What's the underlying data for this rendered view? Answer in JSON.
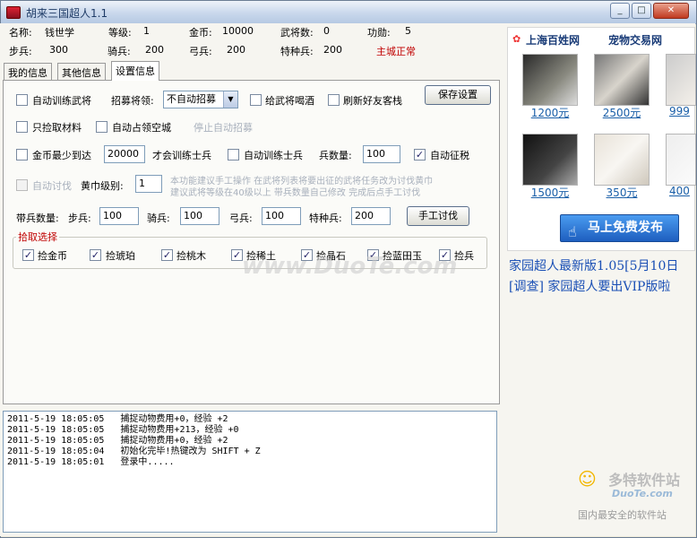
{
  "window": {
    "title": "胡来三国超人1.1"
  },
  "info": {
    "name_label": "名称:",
    "name": "钱世学",
    "level_label": "等级:",
    "level": "1",
    "gold_label": "金币:",
    "gold": "10000",
    "generals_label": "武将数:",
    "generals": "0",
    "merit_label": "功勋:",
    "merit": "5",
    "infantry_label": "步兵:",
    "infantry": "300",
    "cavalry_label": "骑兵:",
    "cavalry": "200",
    "archer_label": "弓兵:",
    "archer": "200",
    "special_label": "特种兵:",
    "special": "200",
    "status": "主城正常"
  },
  "tabs": [
    "我的信息",
    "其他信息",
    "设置信息"
  ],
  "settings": {
    "auto_train_general": "自动训练武将",
    "recruit_label": "招募将领:",
    "recruit_value": "不自动招募",
    "give_wine": "给武将喝酒",
    "refresh_friend": "刷新好友客栈",
    "save_button": "保存设置",
    "only_pick": "只捡取材料",
    "auto_occupy": "自动占领空城",
    "stop_recruit": "停止自动招募",
    "gold_min_label": "金币最少到达",
    "gold_min": "20000",
    "train_soldier_note": "才会训练士兵",
    "auto_train_soldier": "自动训练士兵",
    "soldier_count_label": "兵数量:",
    "soldier_count": "100",
    "auto_tax": "自动征税",
    "auto_attack": "自动讨伐",
    "yellow_level_label": "黄巾级别:",
    "yellow_level": "1",
    "note1": "本功能建议手工操作 在武将列表将要出征的武将任务改为讨伐黄巾",
    "note2": "建议武将等级在40级以上 带兵数量自己修改 完成后点手工讨伐",
    "troops_label": "带兵数量:",
    "inf_label": "步兵:",
    "inf": "100",
    "cav_label": "骑兵:",
    "cav": "100",
    "arc_label": "弓兵:",
    "arc": "100",
    "spe_label": "特种兵:",
    "spe": "200",
    "manual_attack": "手工讨伐",
    "pick_group": "拾取选择",
    "pick_items": [
      "捡金币",
      "捡琥珀",
      "捡桃木",
      "捡稀土",
      "捡晶石",
      "捡蓝田玉",
      "捡兵"
    ]
  },
  "log": [
    "2011-5-19 18:05:05   捕捉动物费用+0，经验 +2",
    "2011-5-19 18:05:05   捕捉动物费用+213，经验 +0",
    "2011-5-19 18:05:05   捕捉动物费用+0，经验 +2",
    "2011-5-19 18:05:04   初始化完毕!热键改为 SHIFT + Z",
    "2011-5-19 18:05:01   登录中....."
  ],
  "ad": {
    "brand": "上海百姓网",
    "category": "宠物交易网",
    "prices": [
      "1200元",
      "2500元",
      "999",
      "1500元",
      "350元",
      "400"
    ],
    "publish": "马上免费发布",
    "news1": "家园超人最新版1.05[5月10日",
    "news2": "[调查] 家园超人要出VIP版啦"
  },
  "watermark": {
    "site": "www.DuoTe.com",
    "logo_name": "多特软件站",
    "logo_url": "DuoTe.com",
    "slogan": "国内最安全的软件站"
  }
}
